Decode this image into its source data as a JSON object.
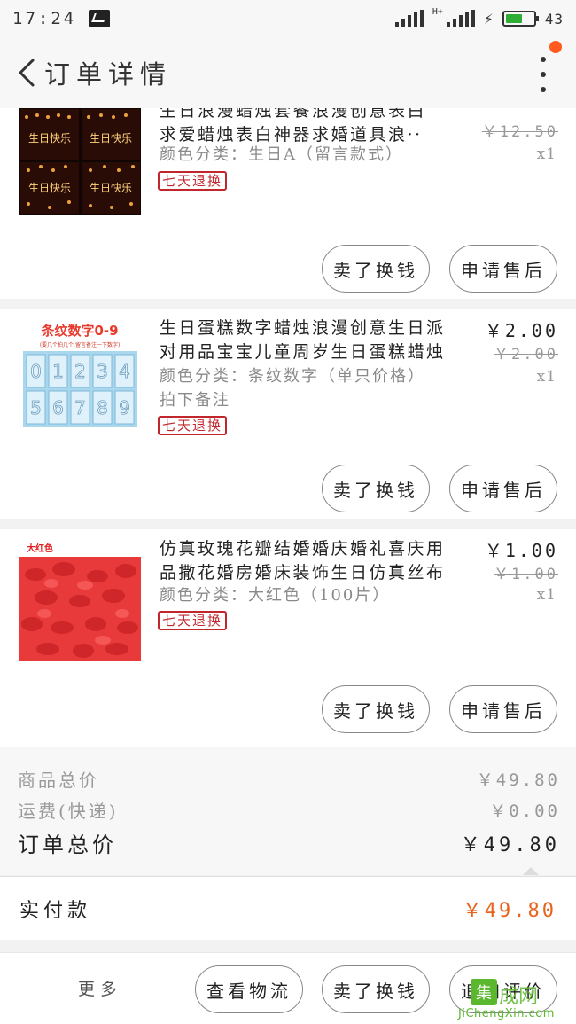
{
  "status_bar": {
    "time": "17:24",
    "battery_level": "43",
    "battery_fraction": 0.6,
    "network_label": "H+"
  },
  "nav": {
    "title": "订单详情"
  },
  "items": [
    {
      "title_line1": "生日浪漫蜡烛套餐浪漫创意表白",
      "title_line2": "求爱蜡烛表白神器求婚道具浪··",
      "spec": "颜色分类：生日A（留言款式）",
      "note": "",
      "tag": "七天退换",
      "price": "",
      "original_price": "￥12.50",
      "quantity": "x1",
      "thumb_labels": [
        "生日快乐",
        "生日快乐",
        "生日快乐",
        "生日快乐"
      ],
      "btn_refund": "卖了换钱",
      "btn_service": "申请售后"
    },
    {
      "title_line1": "生日蛋糕数字蜡烛浪漫创意生日派",
      "title_line2": "对用品宝宝儿童周岁生日蛋糕蜡烛",
      "spec": "颜色分类：条纹数字（单只价格）",
      "note": "拍下备注",
      "tag": "七天退换",
      "price": "￥2.00",
      "original_price": "￥2.00",
      "quantity": "x1",
      "thumb_heading": "条纹数字0-9",
      "thumb_sub": "(要几个拍几个,留言备注一下数字)",
      "thumb_digits": [
        "0",
        "1",
        "2",
        "3",
        "4",
        "5",
        "6",
        "7",
        "8",
        "9"
      ],
      "btn_refund": "卖了换钱",
      "btn_service": "申请售后"
    },
    {
      "title_line1": "仿真玫瑰花瓣结婚婚庆婚礼喜庆用",
      "title_line2": "品撒花婚房婚床装饰生日仿真丝布",
      "spec": "颜色分类：大红色（100片）",
      "note": "",
      "tag": "七天退换",
      "price": "￥1.00",
      "original_price": "￥1.00",
      "quantity": "x1",
      "thumb_heading": "大红色",
      "btn_refund": "卖了换钱",
      "btn_service": "申请售后"
    }
  ],
  "summary": {
    "subtotal_label": "商品总价",
    "subtotal_value": "￥49.80",
    "shipping_label": "运费(快递)",
    "shipping_value": "￥0.00",
    "total_label": "订单总价",
    "total_value": "￥49.80"
  },
  "paid": {
    "label": "实付款",
    "value": "￥49.80"
  },
  "bottom_bar": {
    "more_label": "更多",
    "logistics_label": "查看物流",
    "sell_label": "卖了换钱",
    "review_label": "追加评价"
  },
  "watermark": {
    "logo_char": "集",
    "logo_text": "成网",
    "url": "JiChengXin.com"
  },
  "colors": {
    "accent": "#e8641e",
    "tag_red": "#c0262c",
    "notification": "#ff5a1f",
    "battery_green": "#2fae35"
  }
}
